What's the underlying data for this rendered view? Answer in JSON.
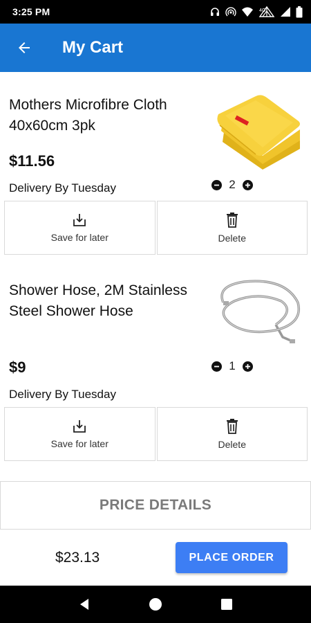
{
  "status_bar": {
    "time": "3:25 PM"
  },
  "header": {
    "title": "My Cart"
  },
  "cart_items": [
    {
      "name": "Mothers Microfibre Cloth 40x60cm 3pk",
      "price": "$11.56",
      "delivery": "Delivery By Tuesday",
      "quantity": "2",
      "image": "yellow-microfibre-cloth-image",
      "save_label": "Save for later",
      "delete_label": "Delete"
    },
    {
      "name": "Shower Hose, 2M Stainless Steel Shower Hose",
      "price": "$9",
      "delivery": "Delivery By Tuesday",
      "quantity": "1",
      "image": "shower-hose-image",
      "save_label": "Save for later",
      "delete_label": "Delete"
    }
  ],
  "price_details": {
    "label": "PRICE DETAILS"
  },
  "footer": {
    "total": "$23.13",
    "place_order_label": "PLACE ORDER"
  },
  "colors": {
    "app_bar": "#1976d2",
    "button": "#3d7ef4",
    "status_bar": "#000000"
  },
  "icons": [
    "back-arrow-icon",
    "headset-icon",
    "hotspot-icon",
    "wifi-icon",
    "network-icon",
    "signal-icon",
    "battery-icon",
    "minus-icon",
    "plus-icon",
    "save-icon",
    "trash-icon",
    "nav-back-icon",
    "nav-home-icon",
    "nav-recents-icon"
  ]
}
